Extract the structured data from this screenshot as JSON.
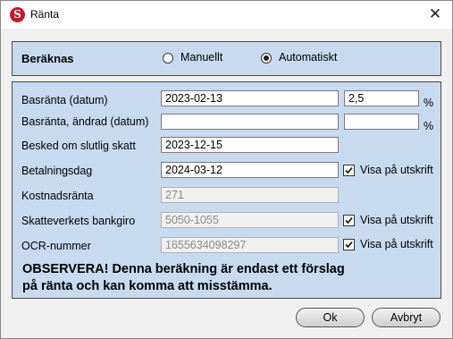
{
  "window": {
    "title": "Ränta",
    "app_icon_letter": "S"
  },
  "calc": {
    "label": "Beräknas",
    "options": [
      {
        "label": "Manuellt",
        "checked": false
      },
      {
        "label": "Automatiskt",
        "checked": true
      }
    ]
  },
  "fields": {
    "basranta": {
      "label": "Basränta (datum)",
      "value": "2023-02-13",
      "percent": "2,5",
      "unit": "%"
    },
    "basranta_andrad": {
      "label": "Basränta, ändrad (datum)",
      "value": "",
      "percent": "",
      "unit": "%"
    },
    "besked": {
      "label": "Besked om slutlig skatt",
      "value": "2023-12-15"
    },
    "betalningsdag": {
      "label": "Betalningsdag",
      "value": "2024-03-12",
      "checkbox_label": "Visa på utskrift",
      "checked": true
    },
    "kostnadsranta": {
      "label": "Kostnadsränta",
      "value": "271"
    },
    "bankgiro": {
      "label": "Skatteverkets bankgiro",
      "value": "5050-1055",
      "checkbox_label": "Visa på utskrift",
      "checked": true
    },
    "ocr": {
      "label": "OCR-nummer",
      "value": "1655634098297",
      "checkbox_label": "Visa på utskrift",
      "checked": true
    }
  },
  "notice": {
    "line1": "OBSERVERA! Denna beräkning är endast ett förslag",
    "line2": "på ränta och kan komma att misstämma."
  },
  "buttons": {
    "ok": "Ok",
    "cancel": "Avbryt"
  }
}
